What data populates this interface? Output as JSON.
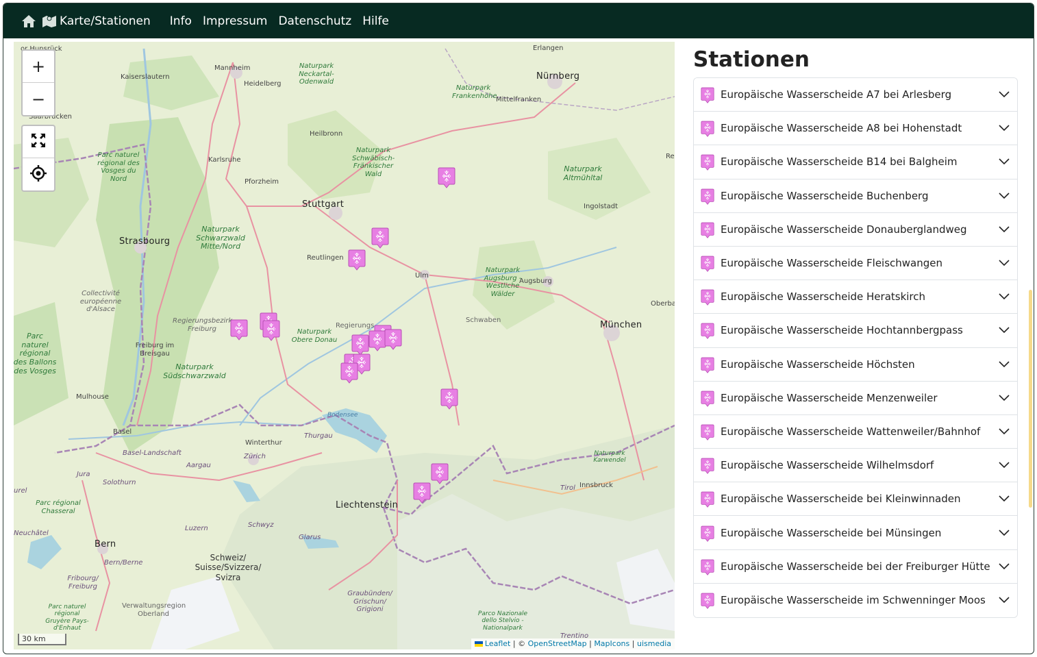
{
  "navbar": {
    "home_icon": "home-icon",
    "map_icon": "map-icon",
    "items": [
      {
        "label": "Karte/Stationen"
      },
      {
        "label": "Info"
      },
      {
        "label": "Impressum"
      },
      {
        "label": "Datenschutz"
      },
      {
        "label": "Hilfe"
      }
    ]
  },
  "map": {
    "zoom_in": "+",
    "zoom_out": "−",
    "fullscreen_icon": "fullscreen-icon",
    "locate_icon": "locate-icon",
    "scale": "30 km",
    "attribution": {
      "leaflet": "Leaflet",
      "sep1": " | © ",
      "osm": "OpenStreetMap",
      "sep2": " | ",
      "mapicons": "MapIcons",
      "sep3": " | ",
      "uismedia": "uismedia"
    },
    "labels": {
      "hunsrueck": "or Hunsrück",
      "erlangen": "Erlangen",
      "mannheim": "Mannheim",
      "kaiserslautern": "Kaiserslautern",
      "heidelberg": "Heidelberg",
      "neckartal": "Naturpark Neckartal-Odenwald",
      "nuernberg": "Nürnberg",
      "frankenhoehe": "Naturpark Frankenhöhe",
      "mittelfranken": "Mittelfranken",
      "saarbruecken": "Saarbrücken",
      "heilbronn": "Heilbronn",
      "vosges_nord": "Parc naturel régional des Vosges du Nord",
      "karlsruhe": "Karlsruhe",
      "schwaebisch": "Naturpark Schwäbisch-Fränkischer Wald",
      "altmuehltal": "Naturpark Altmühltal",
      "reg": "Reg",
      "pforzheim": "Pforzheim",
      "stuttgart": "Stuttgart",
      "ingolstadt": "Ingolstadt",
      "schwarzwald_mitte": "Naturpark Schwarzwald Mitte/Nord",
      "strasbourg": "Strasbourg",
      "reutlingen": "Reutlingen",
      "ulm": "Ulm",
      "augsburg_westl": "Naturpark Augsburg - Westliche Wälder",
      "augsburg": "Augsburg",
      "alsace": "Collectivité européenne d'Alsace",
      "oberba": "Oberba",
      "reg_freiburg": "Regierungsbezirk Freiburg",
      "regierungs": "Regierungs",
      "schwaben": "Schwaben",
      "muenchen": "München",
      "ballons": "Parc naturel régional des Ballons des Vosges",
      "freiburg": "Freiburg im Breisgau",
      "obere_donau": "Naturpark Obere Donau",
      "suedschwarzwald": "Naturpark Südschwarzwald",
      "mulhouse": "Mulhouse",
      "bodensee": "Bodensee",
      "basel": "Basel",
      "thurgau": "Thurgau",
      "winterthur": "Winterthur",
      "basel_land": "Basel-Landschaft",
      "zuerich": "Zürich",
      "karwendel": "Naturpark Karwendel",
      "aargau": "Aargau",
      "jura": "Jura",
      "solothurn": "Solothurn",
      "innsbruck": "Innsbruck",
      "tirol": "Tirol",
      "liechtenstein": "Liechtenstein",
      "chasseral": "Parc régional Chasseral",
      "urel": "urel",
      "luzern": "Luzern",
      "schwyz": "Schwyz",
      "glarus": "Glarus",
      "neuchatel": "Neuchâtel",
      "bern": "Bern",
      "schweiz": "Schweiz/ Suisse/Svizzera/ Svizra",
      "bern_berne": "Bern/Berne",
      "fribourg": "Fribourg/ Freiburg",
      "graubuenden": "Graubünden/ Grischun/ Grigioni",
      "gruyere": "Parc naturel régional Gruyère Pays-d'Enhaut",
      "oberland": "Verwaltungsregion Oberland",
      "stelvio": "Parco Nazionale dello Stelvio - Nationalpark",
      "trento": "Trentino"
    },
    "marker_icon": "watershed-marker-icon"
  },
  "sidebar": {
    "title": "Stationen",
    "item_icon": "watershed-marker-icon",
    "chevron_icon": "chevron-down-icon",
    "stations": [
      "Europäische Wasserscheide A7 bei Arlesberg",
      "Europäische Wasserscheide A8 bei Hohenstadt",
      "Europäische Wasserscheide B14 bei Balgheim",
      "Europäische Wasserscheide Buchenberg",
      "Europäische Wasserscheide Donauberglandweg",
      "Europäische Wasserscheide Fleischwangen",
      "Europäische Wasserscheide Heratskirch",
      "Europäische Wasserscheide Hochtannbergpass",
      "Europäische Wasserscheide Höchsten",
      "Europäische Wasserscheide Menzenweiler",
      "Europäische Wasserscheide Wattenweiler/Bahnhof",
      "Europäische Wasserscheide Wilhelmsdorf",
      "Europäische Wasserscheide bei Kleinwinnaden",
      "Europäische Wasserscheide bei Münsingen",
      "Europäische Wasserscheide bei der Freiburger Hütte",
      "Europäische Wasserscheide im Schwenninger Moos"
    ]
  },
  "colors": {
    "navbar_bg": "#072a22",
    "marker_pink": "#e77fe3",
    "scroll_thumb": "#f5d98a"
  }
}
